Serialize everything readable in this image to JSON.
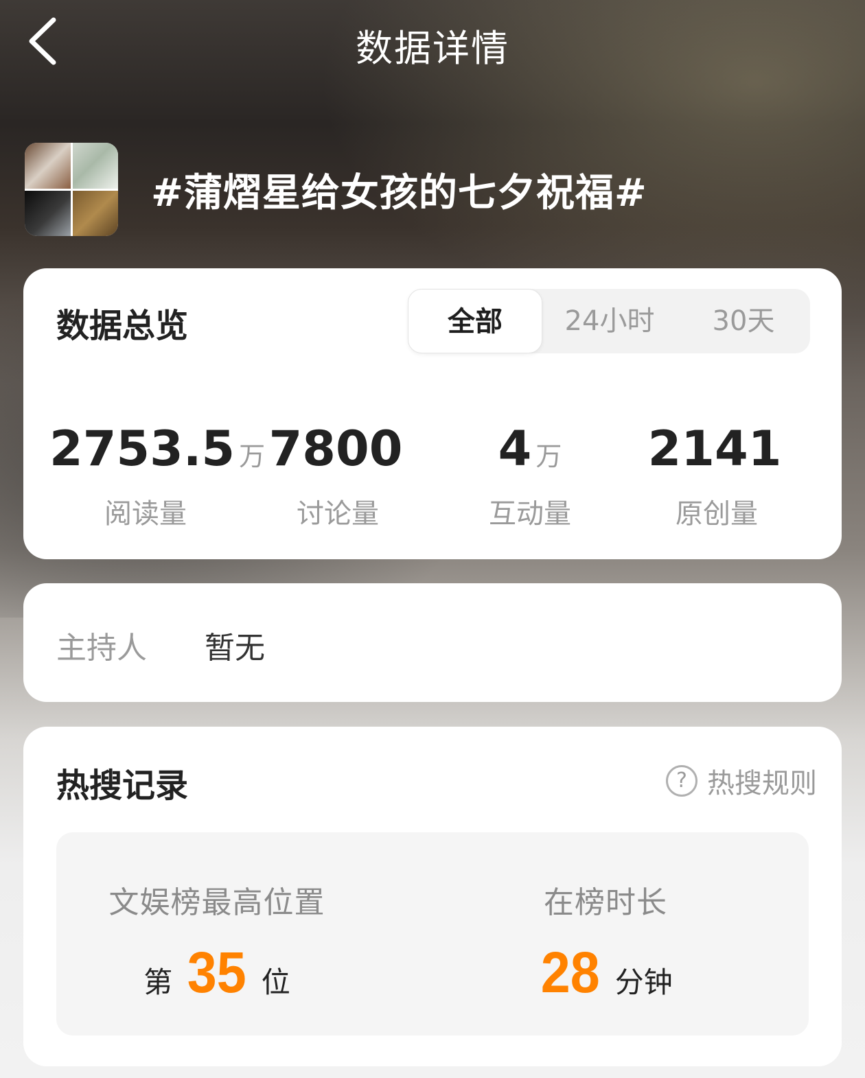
{
  "header": {
    "title": "数据详情",
    "back_icon": "chevron-left-icon"
  },
  "topic": {
    "title": "#蒲熠星给女孩的七夕祝福#"
  },
  "overview": {
    "title": "数据总览",
    "tabs": [
      {
        "label": "全部",
        "active": true
      },
      {
        "label": "24小时",
        "active": false
      },
      {
        "label": "30天",
        "active": false
      }
    ],
    "stats": [
      {
        "value": "2753.5",
        "unit": "万",
        "label": "阅读量"
      },
      {
        "value": "7800",
        "unit": "",
        "label": "讨论量"
      },
      {
        "value": "4",
        "unit": "万",
        "label": "互动量"
      },
      {
        "value": "2141",
        "unit": "",
        "label": "原创量"
      }
    ]
  },
  "host": {
    "label": "主持人",
    "value": "暂无"
  },
  "hot_search": {
    "title": "热搜记录",
    "rules_label": "热搜规则",
    "rules_icon": "question-circle-icon",
    "best_position": {
      "label": "文娱榜最高位置",
      "prefix": "第",
      "value": "35",
      "suffix": "位"
    },
    "duration": {
      "label": "在榜时长",
      "value": "28",
      "suffix": "分钟"
    }
  },
  "colors": {
    "accent": "#ff8200",
    "primary_text": "#222222",
    "secondary_text": "#9a9a9a"
  }
}
